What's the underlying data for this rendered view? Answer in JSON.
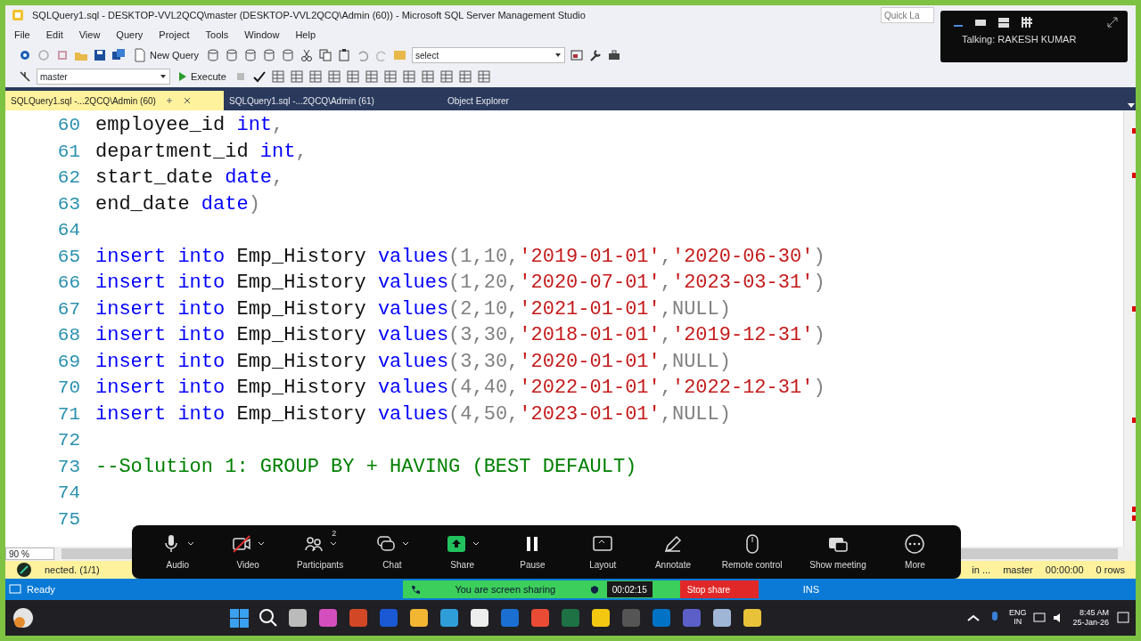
{
  "window": {
    "title": "SQLQuery1.sql - DESKTOP-VVL2QCQ\\master (DESKTOP-VVL2QCQ\\Admin (60)) - Microsoft SQL Server Management Studio"
  },
  "quick_launch": {
    "placeholder": "Quick La"
  },
  "menu": [
    "File",
    "Edit",
    "View",
    "Query",
    "Project",
    "Tools",
    "Window",
    "Help"
  ],
  "toolbar": {
    "new_query": "New Query",
    "search_combo": "select",
    "database": "master",
    "execute": "Execute"
  },
  "tabs": [
    {
      "label": "SQLQuery1.sql -...2QCQ\\Admin (60)",
      "selected": true
    },
    {
      "label": "SQLQuery1.sql -...2QCQ\\Admin (61)",
      "selected": false
    },
    {
      "label": "Object Explorer",
      "selected": false
    }
  ],
  "editor": {
    "lines": [
      {
        "number": "60",
        "tokens": [
          {
            "kind": "plain",
            "text": "employee_id "
          },
          {
            "kind": "keyword",
            "text": "int"
          },
          {
            "kind": "punct",
            "text": ","
          }
        ]
      },
      {
        "number": "61",
        "tokens": [
          {
            "kind": "plain",
            "text": "department_id "
          },
          {
            "kind": "keyword",
            "text": "int"
          },
          {
            "kind": "punct",
            "text": ","
          }
        ]
      },
      {
        "number": "62",
        "tokens": [
          {
            "kind": "plain",
            "text": "start_date "
          },
          {
            "kind": "keyword",
            "text": "date"
          },
          {
            "kind": "punct",
            "text": ","
          }
        ]
      },
      {
        "number": "63",
        "tokens": [
          {
            "kind": "plain",
            "text": "end_date "
          },
          {
            "kind": "keyword",
            "text": "date"
          },
          {
            "kind": "punct",
            "text": ")"
          }
        ]
      },
      {
        "number": "64"
      },
      {
        "number": "65",
        "tokens": [
          {
            "kind": "keyword",
            "text": "insert into "
          },
          {
            "kind": "plain",
            "text": "Emp_History "
          },
          {
            "kind": "keyword",
            "text": "values"
          },
          {
            "kind": "punct",
            "text": "(1,10,"
          },
          {
            "kind": "string",
            "text": "'2019-01-01'"
          },
          {
            "kind": "punct",
            "text": ","
          },
          {
            "kind": "string",
            "text": "'2020-06-30'"
          },
          {
            "kind": "punct",
            "text": ")"
          }
        ]
      },
      {
        "number": "66",
        "tokens": [
          {
            "kind": "keyword",
            "text": "insert into "
          },
          {
            "kind": "plain",
            "text": "Emp_History "
          },
          {
            "kind": "keyword",
            "text": "values"
          },
          {
            "kind": "punct",
            "text": "(1,20,"
          },
          {
            "kind": "string",
            "text": "'2020-07-01'"
          },
          {
            "kind": "punct",
            "text": ","
          },
          {
            "kind": "string",
            "text": "'2023-03-31'"
          },
          {
            "kind": "punct",
            "text": ")"
          }
        ]
      },
      {
        "number": "67",
        "tokens": [
          {
            "kind": "keyword",
            "text": "insert into "
          },
          {
            "kind": "plain",
            "text": "Emp_History "
          },
          {
            "kind": "keyword",
            "text": "values"
          },
          {
            "kind": "punct",
            "text": "(2,10,"
          },
          {
            "kind": "string",
            "text": "'2021-01-01'"
          },
          {
            "kind": "punct",
            "text": ","
          },
          {
            "kind": "null",
            "text": "NULL"
          },
          {
            "kind": "punct",
            "text": ")"
          }
        ]
      },
      {
        "number": "68",
        "tokens": [
          {
            "kind": "keyword",
            "text": "insert into "
          },
          {
            "kind": "plain",
            "text": "Emp_History "
          },
          {
            "kind": "keyword",
            "text": "values"
          },
          {
            "kind": "punct",
            "text": "(3,30,"
          },
          {
            "kind": "string",
            "text": "'2018-01-01'"
          },
          {
            "kind": "punct",
            "text": ","
          },
          {
            "kind": "string",
            "text": "'2019-12-31'"
          },
          {
            "kind": "punct",
            "text": ")"
          }
        ]
      },
      {
        "number": "69",
        "tokens": [
          {
            "kind": "keyword",
            "text": "insert into "
          },
          {
            "kind": "plain",
            "text": "Emp_History "
          },
          {
            "kind": "keyword",
            "text": "values"
          },
          {
            "kind": "punct",
            "text": "(3,30,"
          },
          {
            "kind": "string",
            "text": "'2020-01-01'"
          },
          {
            "kind": "punct",
            "text": ","
          },
          {
            "kind": "null",
            "text": "NULL"
          },
          {
            "kind": "punct",
            "text": ")"
          }
        ]
      },
      {
        "number": "70",
        "tokens": [
          {
            "kind": "keyword",
            "text": "insert into "
          },
          {
            "kind": "plain",
            "text": "Emp_History "
          },
          {
            "kind": "keyword",
            "text": "values"
          },
          {
            "kind": "punct",
            "text": "(4,40,"
          },
          {
            "kind": "string",
            "text": "'2022-01-01'"
          },
          {
            "kind": "punct",
            "text": ","
          },
          {
            "kind": "string",
            "text": "'2022-12-31'"
          },
          {
            "kind": "punct",
            "text": ")"
          }
        ]
      },
      {
        "number": "71",
        "tokens": [
          {
            "kind": "keyword",
            "text": "insert into "
          },
          {
            "kind": "plain",
            "text": "Emp_History "
          },
          {
            "kind": "keyword",
            "text": "values"
          },
          {
            "kind": "punct",
            "text": "(4,50,"
          },
          {
            "kind": "string",
            "text": "'2023-01-01'"
          },
          {
            "kind": "punct",
            "text": ","
          },
          {
            "kind": "null",
            "text": "NULL"
          },
          {
            "kind": "punct",
            "text": ")"
          }
        ]
      },
      {
        "number": "72"
      },
      {
        "number": "73",
        "tokens": [
          {
            "kind": "comment",
            "text": "--Solution 1: GROUP BY + HAVING (BEST DEFAULT)"
          }
        ]
      },
      {
        "number": "74"
      },
      {
        "number": "75"
      }
    ],
    "zoom_level": "90 %"
  },
  "query_status": {
    "connection": "nected. (1/1)",
    "server": "in ...",
    "database": "master",
    "elapsed": "00:00:00",
    "rows": "0 rows"
  },
  "status_bar": {
    "state": "Ready",
    "mode": "INS"
  },
  "meeting_toolbar": [
    {
      "label": "Audio",
      "has_menu": true,
      "off": false
    },
    {
      "label": "Video",
      "has_menu": true,
      "off": true
    },
    {
      "label": "Participants",
      "has_menu": true,
      "off": false,
      "badge": "2"
    },
    {
      "label": "Chat",
      "has_menu": true,
      "off": false
    },
    {
      "label": "Share",
      "has_menu": true,
      "off": false
    },
    {
      "label": "Pause",
      "has_menu": false,
      "off": false
    },
    {
      "label": "Layout",
      "has_menu": false,
      "off": false
    },
    {
      "label": "Annotate",
      "has_menu": false,
      "off": false
    },
    {
      "label": "Remote control",
      "has_menu": false,
      "off": false
    },
    {
      "label": "Show meeting",
      "has_menu": false,
      "off": false
    },
    {
      "label": "More",
      "has_menu": false,
      "off": false
    }
  ],
  "sharing_bar": {
    "message": "You are screen sharing",
    "timer": "00:02:15",
    "stop": "Stop share"
  },
  "talking_panel": {
    "text": "Talking: RAKESH KUMAR"
  },
  "taskbar": {
    "language": "ENG",
    "region": "IN",
    "time": "8:45 AM",
    "date": "25-Jan-26"
  }
}
